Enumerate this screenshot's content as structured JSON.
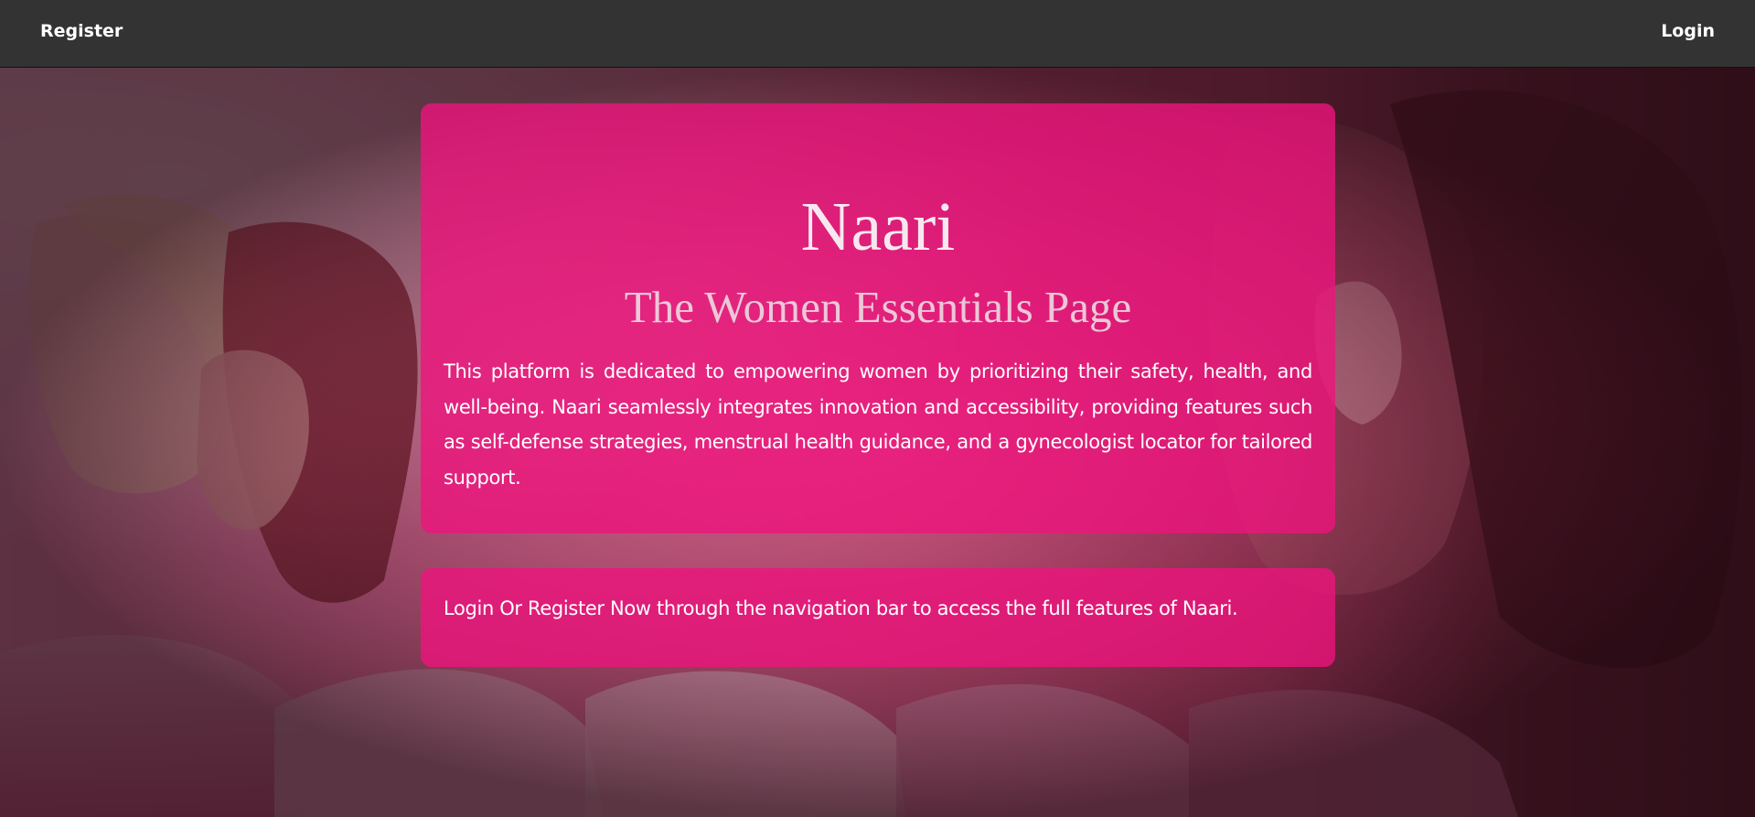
{
  "nav": {
    "register_label": "Register",
    "login_label": "Login"
  },
  "hero": {
    "background_description_colors": {
      "primary_pink": "#ee147d",
      "navbar": "#333333"
    }
  },
  "intro": {
    "title": "Naari",
    "subtitle": "The Women Essentials Page",
    "description": "This platform is dedicated to empowering women by prioritizing their safety, health, and well-being. Naari seamlessly integrates innovation and accessibility, providing features such as self-defense strategies, menstrual health guidance, and a gynecologist locator for tailored support."
  },
  "cta": {
    "text": "Login Or Register Now through the navigation bar to access the full features of Naari."
  }
}
